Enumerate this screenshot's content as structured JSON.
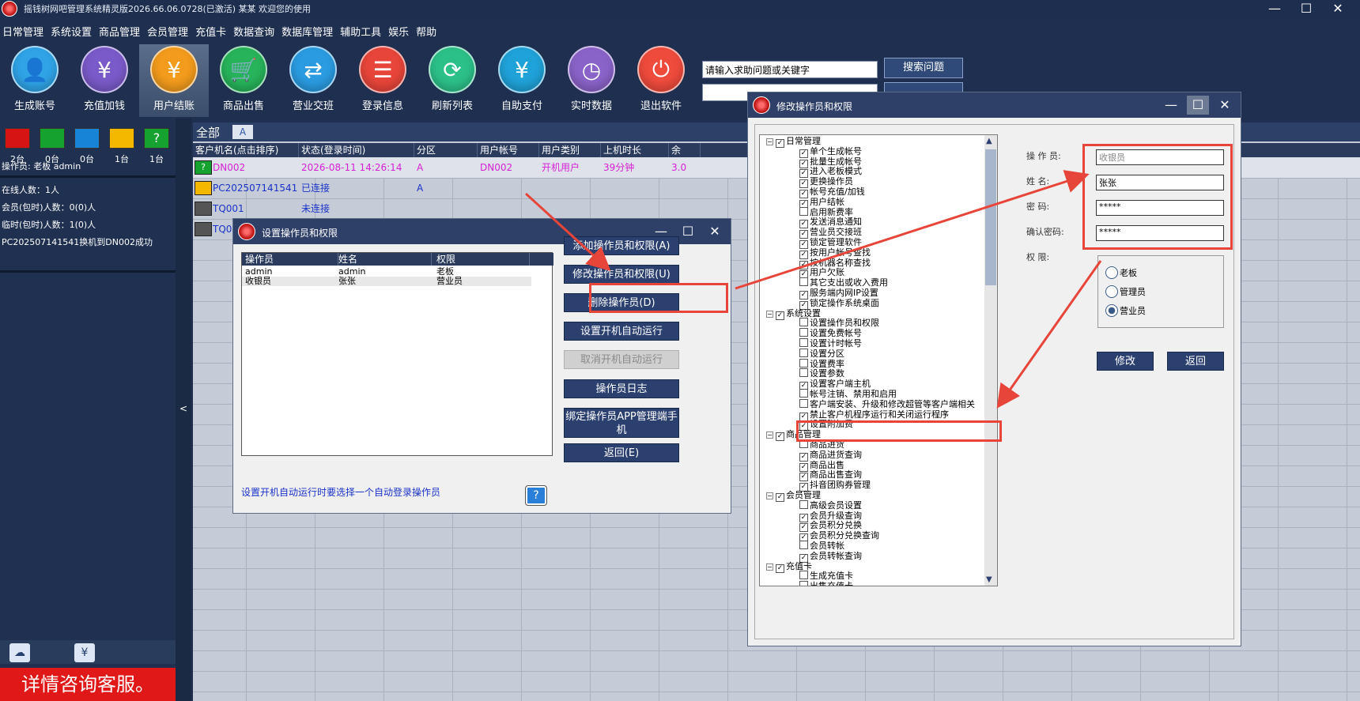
{
  "app": {
    "title": "摇钱树网吧管理系统精灵版2026.66.06.0728(已激活)    某某 欢迎您的使用"
  },
  "menu": [
    "日常管理",
    "系统设置",
    "商品管理",
    "会员管理",
    "充值卡",
    "数据查询",
    "数据库管理",
    "辅助工具",
    "娱乐",
    "帮助"
  ],
  "toolbar": [
    {
      "label": "生成账号",
      "icon": "add-user-icon",
      "color": "#2fa3e6"
    },
    {
      "label": "充值加钱",
      "icon": "yen-icon",
      "color": "#7a5ac8"
    },
    {
      "label": "用户结账",
      "icon": "cashier-icon",
      "color": "#f29b1c"
    },
    {
      "label": "商品出售",
      "icon": "cart-icon",
      "color": "#27b35a"
    },
    {
      "label": "营业交班",
      "icon": "shift-icon",
      "color": "#2a9be0"
    },
    {
      "label": "登录信息",
      "icon": "login-info-icon",
      "color": "#e8453a"
    },
    {
      "label": "刷新列表",
      "icon": "refresh-icon",
      "color": "#2cc089"
    },
    {
      "label": "自助支付",
      "icon": "self-pay-icon",
      "color": "#1fa2d8"
    },
    {
      "label": "实时数据",
      "icon": "realtime-icon",
      "color": "#8a63c8"
    },
    {
      "label": "退出软件",
      "icon": "power-icon",
      "color": "#ef4b3c"
    }
  ],
  "search": {
    "value": "请输入求助问题或关键字",
    "button": "搜索问题"
  },
  "status_counts": [
    {
      "color": "#d61414",
      "count": "2台"
    },
    {
      "color": "#15a22f",
      "count": "0台"
    },
    {
      "color": "#1784d8",
      "count": "0台"
    },
    {
      "color": "#f5b800",
      "count": "1台"
    },
    {
      "color": "#15a22f",
      "count": "1台"
    }
  ],
  "left": {
    "operator": "操作员:  老板 admin",
    "online": "在线人数：1人",
    "member_pkg": "会员(包时)人数：0(0)人",
    "temp_pkg": "临时(包时)人数：1(0)人",
    "log": "PC202507141541换机到DN002成功",
    "banner": "详情咨询客服。",
    "collapse": "<"
  },
  "tabs": {
    "all": "全部",
    "a": "A"
  },
  "columns": [
    "客户机名(点击排序)",
    "状态(登录时间)",
    "分区",
    "用户帐号",
    "用户类别",
    "上机时长",
    "余"
  ],
  "rows": [
    {
      "name": "DN002",
      "status": "2026-08-11 14:26:14",
      "zone": "A",
      "account": "DN002",
      "type": "开机用户",
      "duration": "39分钟",
      "balance": "3.0",
      "color": "#d620d6",
      "mon": "#15a22f"
    },
    {
      "name": "PC202507141541",
      "status": "已连接",
      "zone": "A",
      "account": "",
      "type": "",
      "duration": "",
      "balance": "",
      "color": "#1a33c8",
      "mon": "#f5b800"
    },
    {
      "name": "TQ001",
      "status": "未连接",
      "zone": "",
      "account": "",
      "type": "",
      "duration": "",
      "balance": "",
      "color": "#1a33c8",
      "mon": "#555"
    },
    {
      "name": "TQ0",
      "status": "",
      "zone": "",
      "account": "",
      "type": "",
      "duration": "",
      "balance": "",
      "color": "#1a33c8",
      "mon": "#555"
    }
  ],
  "dlg1": {
    "title": "设置操作员和权限",
    "cols": [
      "操作员",
      "姓名",
      "权限"
    ],
    "rows": [
      {
        "op": "admin",
        "name": "admin",
        "perm": "老板"
      },
      {
        "op": "收银员",
        "name": "张张",
        "perm": "营业员"
      }
    ],
    "buttons": [
      "添加操作员和权限(A)",
      "修改操作员和权限(U)",
      "删除操作员(D)",
      "设置开机自动运行",
      "取消开机自动运行",
      "操作员日志",
      "绑定操作员APP管理端手机",
      "返回(E)"
    ],
    "hint": "设置开机自动运行时要选择一个自动登录操作员"
  },
  "dlg2": {
    "title": "修改操作员和权限",
    "tree": [
      {
        "t": "日常管理",
        "lvl": 0,
        "c": true
      },
      {
        "t": "单个生成帐号",
        "lvl": 1,
        "c": true
      },
      {
        "t": "批量生成帐号",
        "lvl": 1,
        "c": true
      },
      {
        "t": "进入老板模式",
        "lvl": 1,
        "c": true
      },
      {
        "t": "更换操作员",
        "lvl": 1,
        "c": true
      },
      {
        "t": "帐号充值/加钱",
        "lvl": 1,
        "c": true
      },
      {
        "t": "用户结帐",
        "lvl": 1,
        "c": true
      },
      {
        "t": "启用新费率",
        "lvl": 1,
        "c": false
      },
      {
        "t": "发送消息通知",
        "lvl": 1,
        "c": true
      },
      {
        "t": "营业员交接班",
        "lvl": 1,
        "c": true
      },
      {
        "t": "锁定管理软件",
        "lvl": 1,
        "c": true
      },
      {
        "t": "按用户帐号查找",
        "lvl": 1,
        "c": true
      },
      {
        "t": "按机器名称查找",
        "lvl": 1,
        "c": true
      },
      {
        "t": "用户欠账",
        "lvl": 1,
        "c": true
      },
      {
        "t": "其它支出或收入费用",
        "lvl": 1,
        "c": false
      },
      {
        "t": "服务端内网IP设置",
        "lvl": 1,
        "c": true
      },
      {
        "t": "锁定操作系统桌面",
        "lvl": 1,
        "c": true
      },
      {
        "t": "系统设置",
        "lvl": 0,
        "c": true
      },
      {
        "t": "设置操作员和权限",
        "lvl": 1,
        "c": false
      },
      {
        "t": "设置免费帐号",
        "lvl": 1,
        "c": false
      },
      {
        "t": "设置计时帐号",
        "lvl": 1,
        "c": false
      },
      {
        "t": "设置分区",
        "lvl": 1,
        "c": false
      },
      {
        "t": "设置费率",
        "lvl": 1,
        "c": false
      },
      {
        "t": "设置参数",
        "lvl": 1,
        "c": false
      },
      {
        "t": "设置客户端主机",
        "lvl": 1,
        "c": true
      },
      {
        "t": "帐号注销、禁用和启用",
        "lvl": 1,
        "c": false
      },
      {
        "t": "客户端安装、升级和修改超管等客户端相关",
        "lvl": 1,
        "c": false
      },
      {
        "t": "禁止客户机程序运行和关闭运行程序",
        "lvl": 1,
        "c": true
      },
      {
        "t": "设置附加费",
        "lvl": 1,
        "c": true
      },
      {
        "t": "商品管理",
        "lvl": 0,
        "c": true
      },
      {
        "t": "商品进货",
        "lvl": 1,
        "c": false
      },
      {
        "t": "商品进货查询",
        "lvl": 1,
        "c": true
      },
      {
        "t": "商品出售",
        "lvl": 1,
        "c": true
      },
      {
        "t": "商品出售查询",
        "lvl": 1,
        "c": true
      },
      {
        "t": "抖音团购券管理",
        "lvl": 1,
        "c": true
      },
      {
        "t": "会员管理",
        "lvl": 0,
        "c": true
      },
      {
        "t": "高级会员设置",
        "lvl": 1,
        "c": false
      },
      {
        "t": "会员升级查询",
        "lvl": 1,
        "c": true
      },
      {
        "t": "会员积分兑换",
        "lvl": 1,
        "c": true
      },
      {
        "t": "会员积分兑换查询",
        "lvl": 1,
        "c": true
      },
      {
        "t": "会员转帐",
        "lvl": 1,
        "c": false
      },
      {
        "t": "会员转帐查询",
        "lvl": 1,
        "c": true
      },
      {
        "t": "充值卡",
        "lvl": 0,
        "c": true
      },
      {
        "t": "生成充值卡",
        "lvl": 1,
        "c": false
      },
      {
        "t": "出售充值卡",
        "lvl": 1,
        "c": false
      }
    ],
    "form": {
      "operator_label": "操 作 员:",
      "operator_value": "收银员",
      "name_label": "姓       名:",
      "name_value": "张张",
      "pwd_label": "密       码:",
      "pwd_value": "*****",
      "confirm_label": "确认密码:",
      "confirm_value": "*****",
      "perm_label": "权       限:"
    },
    "radios": [
      {
        "label": "老板",
        "on": false
      },
      {
        "label": "管理员",
        "on": false
      },
      {
        "label": "营业员",
        "on": true
      }
    ],
    "modify": "修改",
    "back": "返回"
  },
  "colors": {
    "accent": "#2c4070",
    "highlight": "#e8453a",
    "title_bar": "#2f4068"
  }
}
